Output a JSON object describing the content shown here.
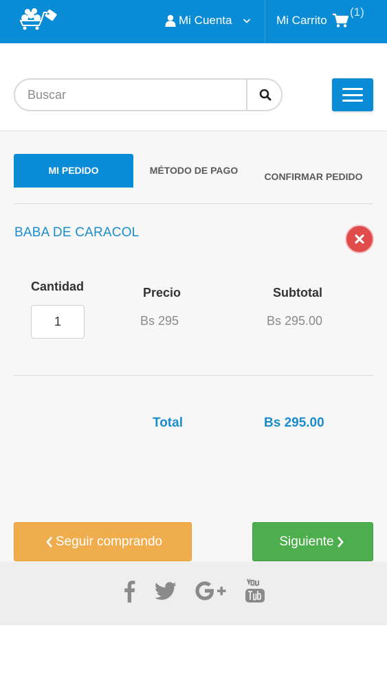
{
  "header": {
    "account_label": "Mi Cuenta",
    "cart_label": "Mi Carrito",
    "cart_count": "(1)",
    "brand_color": "#0a8bd6"
  },
  "search": {
    "placeholder": "Buscar",
    "value": ""
  },
  "tabs": [
    {
      "label": "MI PEDIDO",
      "active": true
    },
    {
      "label": "MÉTODO DE PAGO",
      "active": false
    },
    {
      "label": "CONFIRMAR PEDIDO",
      "active": false
    }
  ],
  "order": {
    "product_name": "BABA DE CARACOL",
    "columns": {
      "quantity": "Cantidad",
      "price": "Precio",
      "subtotal": "Subtotal"
    },
    "quantity": "1",
    "price": "Bs 295",
    "subtotal": "Bs 295.00",
    "total_label": "Total",
    "total_value": "Bs 295.00"
  },
  "actions": {
    "back_label": "Seguir comprando",
    "next_label": "Siguiente",
    "back_color": "#f0ad4e",
    "next_color": "#4cae4c"
  },
  "footer": {
    "social_icons": [
      "facebook-icon",
      "twitter-icon",
      "google-plus-icon",
      "youtube-icon"
    ]
  }
}
